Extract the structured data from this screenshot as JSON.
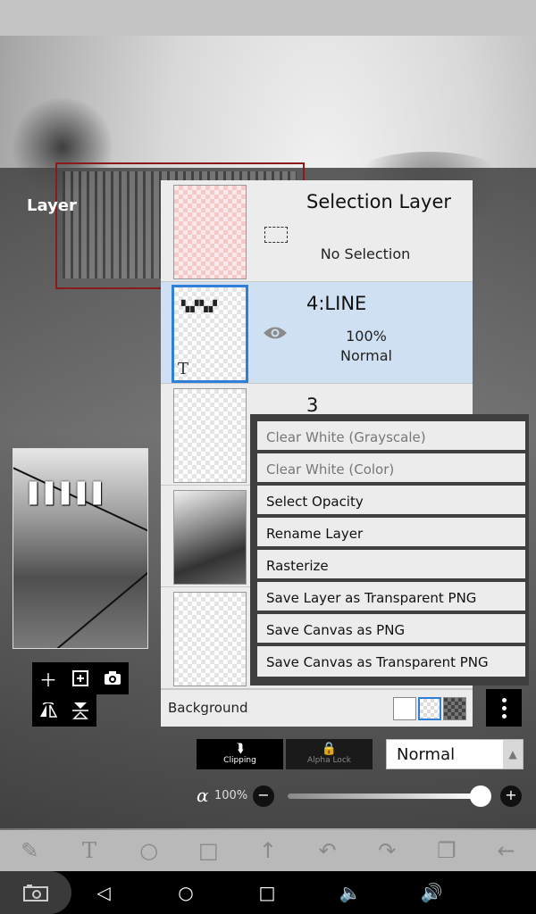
{
  "panel": {
    "title": "Layer"
  },
  "layers": [
    {
      "name": "Selection Layer",
      "sub1": "No Selection",
      "sub2": ""
    },
    {
      "name": "4:LINE",
      "sub1": "100%",
      "sub2": "Normal"
    },
    {
      "name": "3",
      "sub1": "",
      "sub2": ""
    }
  ],
  "background_label": "Background",
  "context_menu": {
    "items": [
      "Clear White (Grayscale)",
      "Clear White (Color)",
      "Select Opacity",
      "Rename Layer",
      "Rasterize",
      "Save Layer as Transparent PNG",
      "Save Canvas as PNG",
      "Save Canvas as Transparent PNG"
    ],
    "disabled": [
      0,
      1
    ]
  },
  "blend": {
    "clipping_label": "Clipping",
    "alpha_lock_label": "Alpha Lock",
    "mode": "Normal"
  },
  "opacity": {
    "symbol": "α",
    "value_label": "100%",
    "value": 100
  },
  "icons": {
    "add": "plus-icon",
    "add_image": "add-image-icon",
    "camera": "camera-icon",
    "flip_h": "flip-horizontal-icon",
    "flip_v": "flip-vertical-icon",
    "visibility": "eye-icon"
  }
}
